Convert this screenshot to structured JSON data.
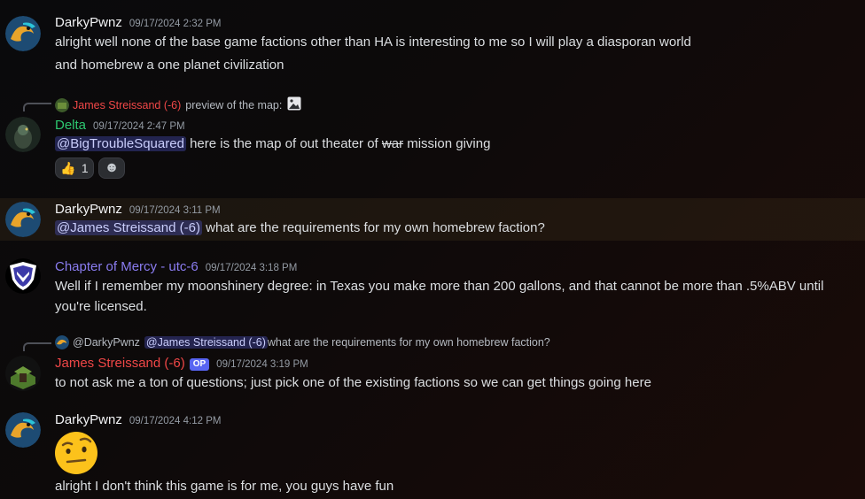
{
  "messages": [
    {
      "author": "DarkyPwnz",
      "timestamp": "09/17/2024 2:32 PM",
      "lines": [
        "alright well none of the base game factions other than HA is interesting to me so I will play a diasporan world",
        "and homebrew a one planet civilization"
      ]
    },
    {
      "reply": {
        "author": "James Streissand (-6)",
        "text": "preview of the map:"
      },
      "author": "Delta",
      "timestamp": "09/17/2024 2:47 PM",
      "mention": "@BigTroubleSquared",
      "text_a": " here is the map of out theater of ",
      "text_strike": "war",
      "text_b": " mission giving",
      "reactions": {
        "thumbs_count": "1",
        "thumbs_emoji": "👍",
        "add_emoji": "☻"
      }
    },
    {
      "author": "DarkyPwnz",
      "timestamp": "09/17/2024 3:11 PM",
      "mention": "@James Streissand (-6)",
      "text": " what are the requirements for my own homebrew faction?"
    },
    {
      "author": "Chapter of Mercy - utc-6",
      "timestamp": "09/17/2024 3:18 PM",
      "lines": [
        "Well if I remember my moonshinery degree: in Texas you make more than 200 gallons, and that cannot be more than .5%ABV until",
        "you're licensed."
      ]
    },
    {
      "reply": {
        "author": "@DarkyPwnz",
        "mention": "@James Streissand (-6)",
        "text": " what are the requirements for my own homebrew faction?"
      },
      "author": "James Streissand (-6)",
      "badge": "OP",
      "timestamp": "09/17/2024 3:19 PM",
      "text": "to not ask me a ton of questions; just pick one of the existing factions so we can get things going here"
    },
    {
      "author": "DarkyPwnz",
      "timestamp": "09/17/2024 4:12 PM",
      "emoji": "🤨",
      "text": "alright I don't think this game is for me, you guys have fun"
    }
  ],
  "colors": {
    "delta": "#2dc770",
    "mercy": "#8a7cf0",
    "james": "#f04747",
    "default": "#f2f3f5"
  }
}
